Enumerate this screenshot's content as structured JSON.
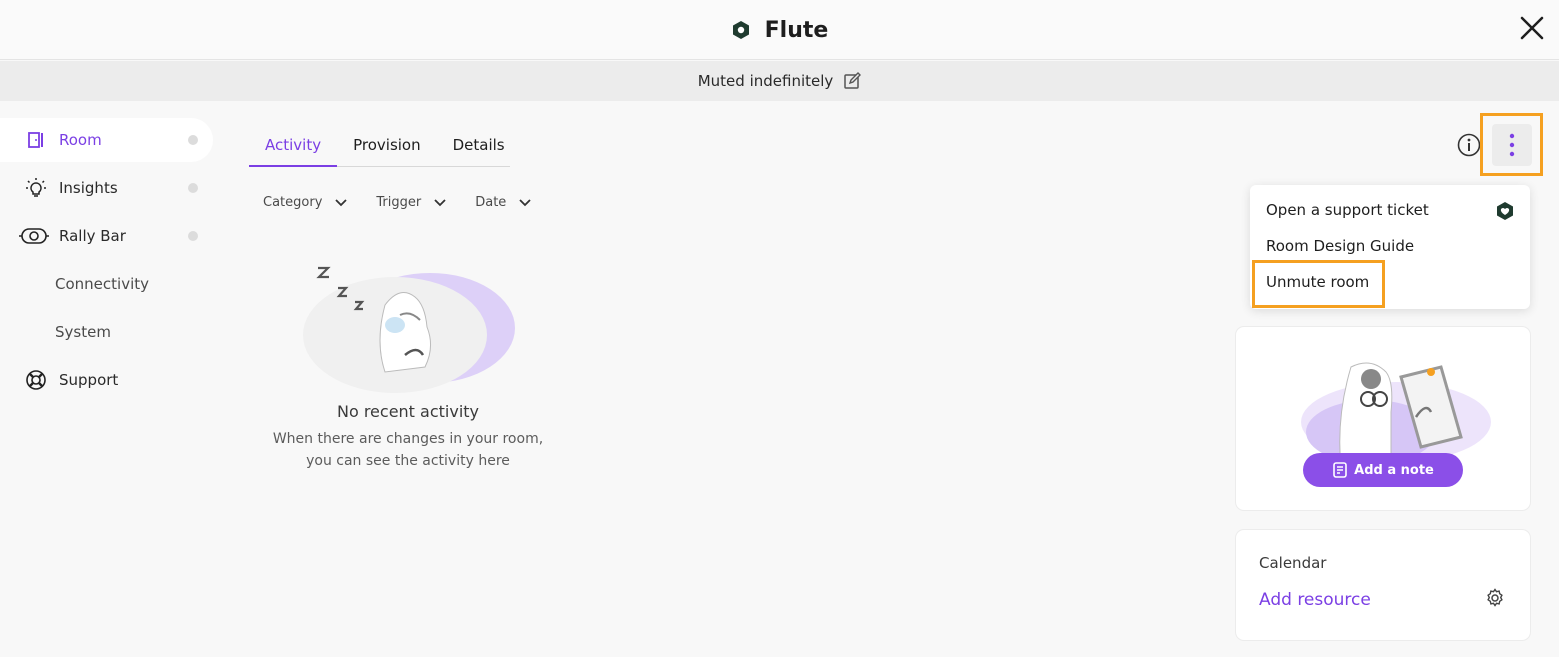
{
  "header": {
    "title": "Flute",
    "status": "Muted indefinitely"
  },
  "sidebar": {
    "items": [
      {
        "label": "Room",
        "icon": "room-icon",
        "active": true
      },
      {
        "label": "Insights",
        "icon": "lightbulb-icon"
      },
      {
        "label": "Rally Bar",
        "icon": "camera-icon"
      },
      {
        "label": "Connectivity"
      },
      {
        "label": "System"
      },
      {
        "label": "Support",
        "icon": "lifebuoy-icon"
      }
    ]
  },
  "tabs": [
    "Activity",
    "Provision",
    "Details"
  ],
  "filters": [
    "Category",
    "Trigger",
    "Date"
  ],
  "empty": {
    "title": "No recent activity",
    "line1": "When there are changes in your room,",
    "line2": "you can see the activity here"
  },
  "menu": {
    "items": [
      "Open a support ticket",
      "Room Design Guide",
      "Unmute room"
    ]
  },
  "note": {
    "button": "Add a note"
  },
  "calendar": {
    "title": "Calendar",
    "link": "Add resource"
  },
  "colors": {
    "accent": "#7b3fe4",
    "highlight": "#f5a020",
    "button": "#8b4fe8"
  }
}
